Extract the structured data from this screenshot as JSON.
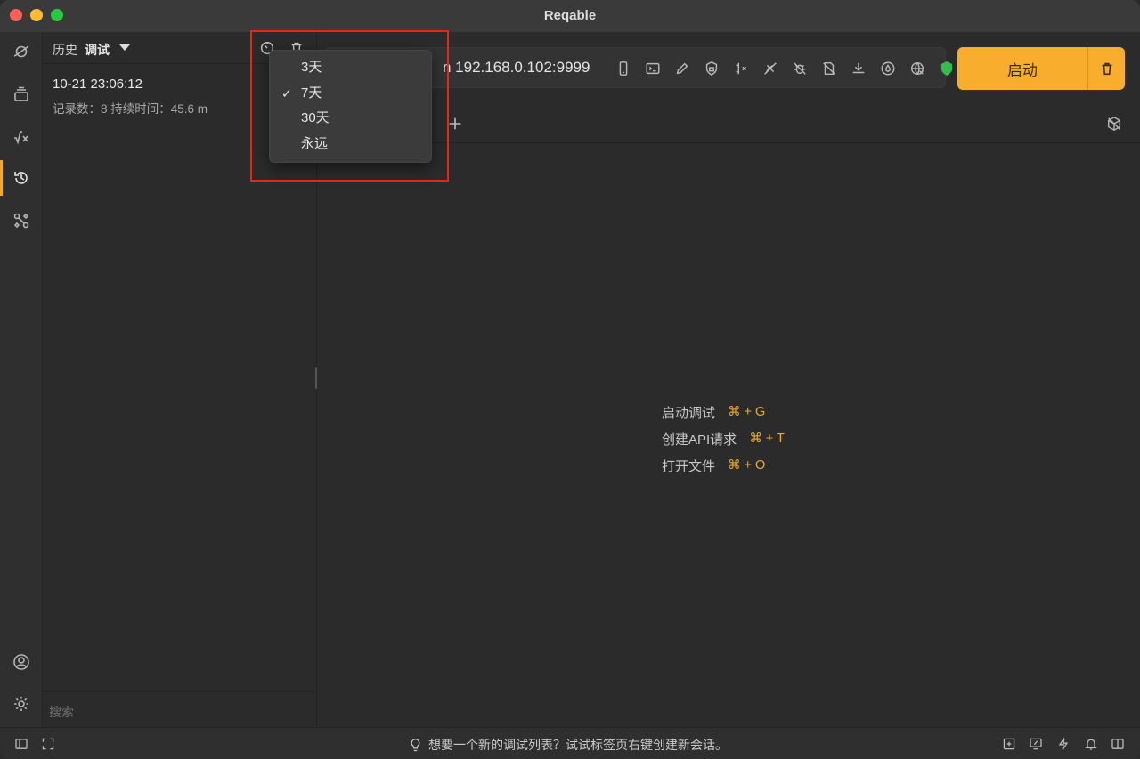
{
  "window": {
    "title": "Reqable"
  },
  "history": {
    "label": "历史",
    "mode": "调试",
    "record": {
      "time": "10-21 23:06:12",
      "meta": "记录数：8  持续时间：45.6 m"
    },
    "search_placeholder": "搜索"
  },
  "dropdown": {
    "items": [
      {
        "label": "3天",
        "checked": false
      },
      {
        "label": "7天",
        "checked": true
      },
      {
        "label": "30天",
        "checked": false
      },
      {
        "label": "永远",
        "checked": false
      }
    ],
    "check_glyph": "✓"
  },
  "proxy": {
    "address_text": "n 192.168.0.102:9999"
  },
  "toolbar": {
    "start_label": "启动"
  },
  "shortcuts": [
    {
      "label": "启动调试",
      "key": "⌘ + G"
    },
    {
      "label": "创建API请求",
      "key": "⌘ + T"
    },
    {
      "label": "打开文件",
      "key": "⌘ + O"
    }
  ],
  "statusbar": {
    "hint": "想要一个新的调试列表？试试标签页右键创建新会话。"
  },
  "colors": {
    "accent": "#f8ad2c",
    "highlight": "#e0291c",
    "shield": "#2fbf4a"
  }
}
